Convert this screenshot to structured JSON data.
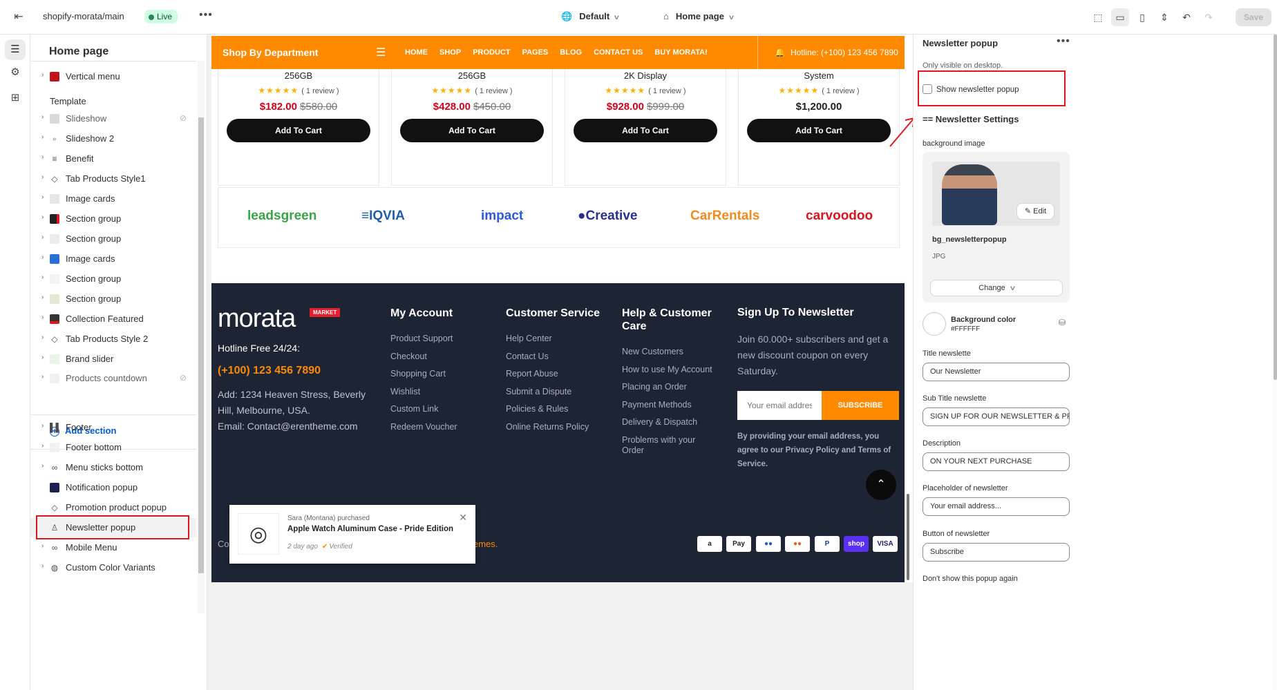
{
  "topbar": {
    "store": "shopify-morata/main",
    "status": "Live",
    "theme": "Default",
    "page": "Home page",
    "save_label": "Save"
  },
  "sidebar": {
    "title": "Home page",
    "items_top": [
      {
        "label": "Vertical menu",
        "icon": "menu-block-icon",
        "color": "#c0131b"
      }
    ],
    "template_label": "Template",
    "template_items": [
      {
        "label": "Slideshow",
        "muted": true,
        "hidden": true
      },
      {
        "label": "Slideshow 2"
      },
      {
        "label": "Benefit"
      },
      {
        "label": "Tab Products Style1"
      },
      {
        "label": "Image cards"
      },
      {
        "label": "Section group"
      },
      {
        "label": "Section group"
      },
      {
        "label": "Image cards"
      },
      {
        "label": "Section group"
      },
      {
        "label": "Section group"
      },
      {
        "label": "Collection Featured"
      },
      {
        "label": "Tab Products Style 2"
      },
      {
        "label": "Brand slider"
      },
      {
        "label": "Products countdown",
        "muted": true,
        "hidden": true
      }
    ],
    "add_section": "Add section",
    "footer_items": [
      {
        "label": "Footer"
      },
      {
        "label": "Footer bottom"
      },
      {
        "label": "Menu sticks bottom"
      },
      {
        "label": "Notification popup"
      },
      {
        "label": "Promotion product popup"
      },
      {
        "label": "Newsletter popup"
      },
      {
        "label": "Mobile Menu"
      },
      {
        "label": "Custom Color Variants"
      }
    ]
  },
  "preview": {
    "nav": {
      "dept": "Shop By Department",
      "links": [
        "HOME",
        "SHOP",
        "PRODUCT",
        "PAGES",
        "BLOG",
        "CONTACT US",
        "BUY MORATA!"
      ],
      "hotline": "Hotline: (+100) 123 456 7890"
    },
    "products": [
      {
        "name": "256GB",
        "reviews": "( 1 review )",
        "price": "$182.00",
        "old": "$580.00",
        "button": "Add To Cart"
      },
      {
        "name": "256GB",
        "reviews": "( 1 review )",
        "price": "$428.00",
        "old": "$450.00",
        "button": "Add To Cart"
      },
      {
        "name": "2K Display",
        "reviews": "( 1 review )",
        "price": "$928.00",
        "old": "$999.00",
        "button": "Add To Cart"
      },
      {
        "name": "System",
        "reviews": "( 1 review )",
        "price": "$1,200.00",
        "old": "",
        "button": "Add To Cart"
      }
    ],
    "brands": [
      {
        "name": "leadsgreen",
        "color": "#3aa34a"
      },
      {
        "name": "≡IQVIA",
        "color": "#1f5fa6"
      },
      {
        "name": "impact",
        "color": "#2b5bd7"
      },
      {
        "name": "●Creative",
        "color": "#2b2f8a"
      },
      {
        "name": "CarRentals",
        "color": "#f08b1f"
      },
      {
        "name": "carvoodoo",
        "color": "#d7151d"
      }
    ],
    "footer": {
      "logo": "morata",
      "market": "MARKET",
      "hotline_label": "Hotline Free 24/24:",
      "phone": "(+100) 123 456 7890",
      "address": "Add: 1234 Heaven Stress, Beverly Hill, Melbourne, USA.",
      "email": "Email: Contact@erentheme.com",
      "columns": [
        {
          "title": "My Account",
          "links": [
            "Product Support",
            "Checkout",
            "Shopping Cart",
            "Wishlist",
            "Custom Link",
            "Redeem Voucher"
          ]
        },
        {
          "title": "Customer Service",
          "links": [
            "Help Center",
            "Contact Us",
            "Report Abuse",
            "Submit a Dispute",
            "Policies & Rules",
            "Online Returns Policy"
          ]
        },
        {
          "title": "Help & Customer Care",
          "links": [
            "New Customers",
            "How to use My Account",
            "Placing an Order",
            "Payment Methods",
            "Delivery & Dispatch",
            "Problems with your Order"
          ]
        }
      ],
      "newsletter_title": "Sign Up To Newsletter",
      "newsletter_text": "Join 60.000+ subscribers and get a new discount coupon on every Saturday.",
      "email_placeholder": "Your email address",
      "subscribe": "SUBSCRIBE",
      "agree": "By providing your email address, you agree to our Privacy Policy and Terms of Service.",
      "copyright_start": "Co",
      "copyright_end": "emes.",
      "payments": [
        "a",
        "Pay",
        "●●",
        "●●",
        "P",
        "shop",
        "VISA"
      ]
    },
    "toast": {
      "who": "Sara (Montana) purchased",
      "what": "Apple Watch Aluminum Case - Pride Edition",
      "when": "2 day ago",
      "verified": "Verified"
    }
  },
  "panel": {
    "title": "Newsletter popup",
    "hint": "Only visible on desktop.",
    "checkbox": "Show newsletter popup",
    "settings_heading": "== Newsletter Settings",
    "bg_image_label": "background image",
    "edit": "Edit",
    "file_name": "bg_newsletterpopup",
    "file_type": "JPG",
    "change": "Change",
    "bg_color_label": "Background color",
    "bg_color_value": "#FFFFFF",
    "fields": [
      {
        "label": "Title newslette",
        "value": "Our Newsletter"
      },
      {
        "label": "Sub Title newslette",
        "value": "SIGN UP FOR OUR NEWSLETTER & PROMOTIONS"
      },
      {
        "label": "Description",
        "value": "ON YOUR NEXT PURCHASE"
      },
      {
        "label": "Placeholder of newsletter",
        "value": "Your email address..."
      },
      {
        "label": "Button of newsletter",
        "value": "Subscribe"
      }
    ],
    "last_label": "Don't show this popup again"
  }
}
